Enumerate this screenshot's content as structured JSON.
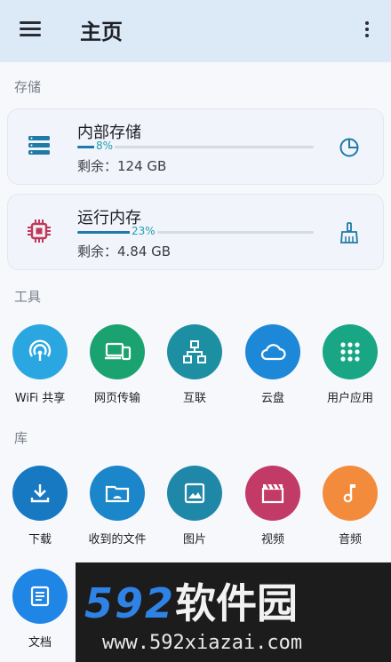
{
  "appbar": {
    "title": "主页",
    "menu_icon": "hamburger-menu-icon",
    "more_icon": "more-vertical-icon",
    "background": "#dceaf8"
  },
  "sections": {
    "storage": "存储",
    "tools": "工具",
    "library": "库"
  },
  "storage_cards": [
    {
      "title": "内部存储",
      "percent_label": "8%",
      "percent": 8,
      "remaining": "剩余：124 GB",
      "icon": "storage-server-icon",
      "action_icon": "pie-chart-icon",
      "accent": "#1f7aa8"
    },
    {
      "title": "运行内存",
      "percent_label": "23%",
      "percent": 23,
      "remaining": "剩余：4.84 GB",
      "icon": "memory-chip-icon",
      "action_icon": "broom-clean-icon",
      "accent": "#c0395a"
    }
  ],
  "tools": [
    {
      "label": "WiFi 共享",
      "icon": "wifi-share-icon",
      "color": "#2aa7e0"
    },
    {
      "label": "网页传输",
      "icon": "devices-icon",
      "color": "#1aa370"
    },
    {
      "label": "互联",
      "icon": "network-hierarchy-icon",
      "color": "#1d8fa3"
    },
    {
      "label": "云盘",
      "icon": "cloud-icon",
      "color": "#1e88d8"
    },
    {
      "label": "用户应用",
      "icon": "apps-grid-icon",
      "color": "#18a684"
    }
  ],
  "library": [
    {
      "label": "下载",
      "icon": "download-icon",
      "color": "#1679c2"
    },
    {
      "label": "收到的文件",
      "icon": "received-folder-icon",
      "color": "#1b86c9"
    },
    {
      "label": "图片",
      "icon": "image-icon",
      "color": "#1f88a8"
    },
    {
      "label": "视频",
      "icon": "video-clapper-icon",
      "color": "#c23a66"
    },
    {
      "label": "音频",
      "icon": "music-note-icon",
      "color": "#f28c3c"
    },
    {
      "label": "文档",
      "icon": "document-icon",
      "color": "#1f86e6"
    }
  ],
  "watermark": {
    "brand_digits": "592",
    "brand_cn": "软件园",
    "url": "www.592xiazai.com"
  }
}
